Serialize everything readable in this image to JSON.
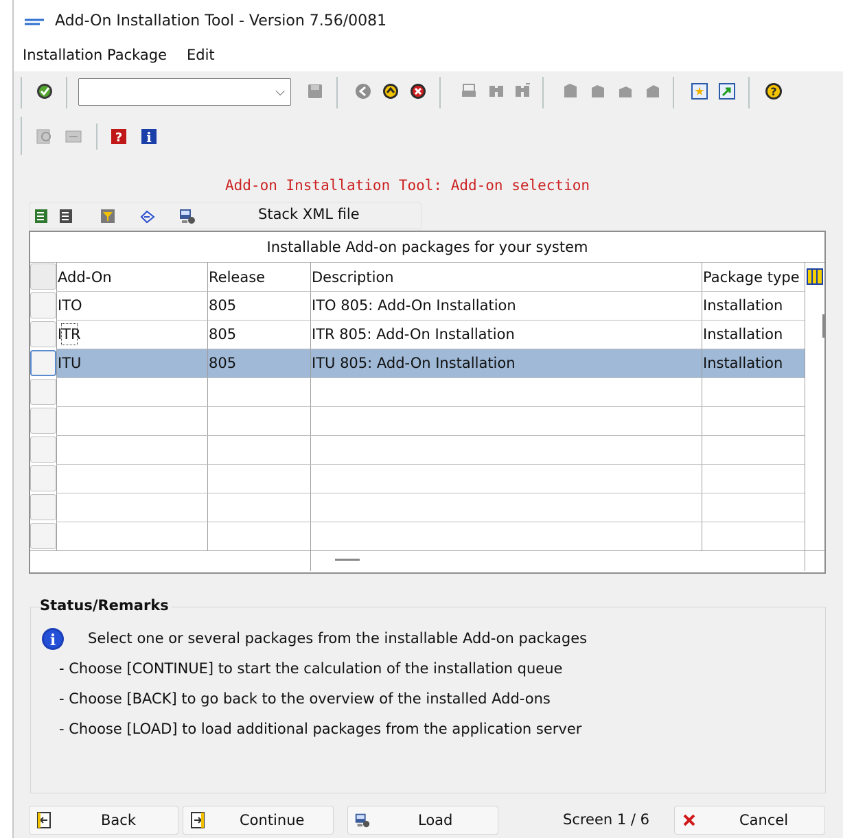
{
  "window": {
    "title": "Add-On Installation Tool - Version 7.56/0081"
  },
  "menubar": {
    "items": [
      {
        "label": "Installation Package"
      },
      {
        "label": "Edit"
      }
    ]
  },
  "toolbar": {
    "command_field": {
      "value": "",
      "placeholder": ""
    },
    "icons": [
      "enter-icon",
      "save-icon",
      "back-icon",
      "exit-icon",
      "cancel-icon",
      "print-icon",
      "find-icon",
      "find-next-icon",
      "first-page-icon",
      "previous-page-icon",
      "next-page-icon",
      "last-page-icon",
      "create-session-icon",
      "shortcut-icon",
      "help-icon"
    ]
  },
  "toolbar2": {
    "icons": [
      "details-icon",
      "select-icon",
      "help-doc-icon",
      "info-icon"
    ]
  },
  "main": {
    "heading": "Add-on Installation Tool: Add-on selection",
    "table_toolbar": {
      "icons": [
        "select-all-icon",
        "deselect-all-icon",
        "filter-icon",
        "refresh-icon",
        "load-stack-icon"
      ],
      "stack_button_label": "Stack XML file"
    },
    "grid": {
      "title": "Installable Add-on packages for your system",
      "columns": [
        "Add-On",
        "Release",
        "Description",
        "Package type"
      ],
      "rows": [
        {
          "addon": "ITO",
          "release": "805",
          "description": "ITO 805: Add-On Installation",
          "type": "Installation",
          "selected": false
        },
        {
          "addon": "ITR",
          "release": "805",
          "description": "ITR 805: Add-On Installation",
          "type": "Installation",
          "selected": false
        },
        {
          "addon": "ITU",
          "release": "805",
          "description": "ITU 805: Add-On Installation",
          "type": "Installation",
          "selected": true
        }
      ],
      "empty_rows": 6,
      "selection_color": "#9fb9d6"
    }
  },
  "status": {
    "title": "Status/Remarks",
    "lines": [
      "Select one or several packages from the installable Add-on packages",
      "- Choose [CONTINUE] to start the calculation of the installation queue",
      "- Choose [BACK] to go back to the overview of the installed Add-ons",
      "- Choose [LOAD] to load additional packages from the application server"
    ]
  },
  "footer": {
    "back_label": "Back",
    "continue_label": "Continue",
    "load_label": "Load",
    "screen_text": "Screen 1 / 6",
    "cancel_label": "Cancel"
  }
}
